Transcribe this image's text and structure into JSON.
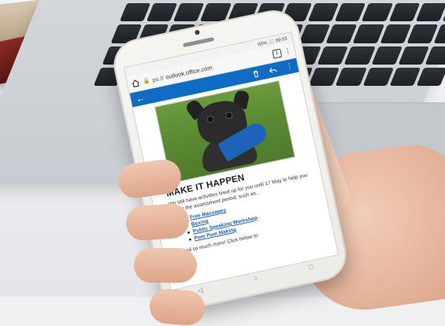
{
  "status_bar": {
    "info": "65% ⬜ 09:53"
  },
  "browser": {
    "url_scheme": "ps://",
    "url_host": "outlook.office.com",
    "tab_count": "1"
  },
  "email": {
    "headline": "MAKE IT HAPPEN",
    "body": "We still have activities lined up for you until 17 May to help you during the assessment period, such as...",
    "links": [
      "Free Massages",
      "Boxing",
      "Public Speaking Workshop",
      "Pom Pom Making"
    ],
    "footer_text": "...and so much more! Click below to"
  },
  "colors": {
    "outlook_blue": "#0f6cc2",
    "link": "#1b5ca7"
  }
}
